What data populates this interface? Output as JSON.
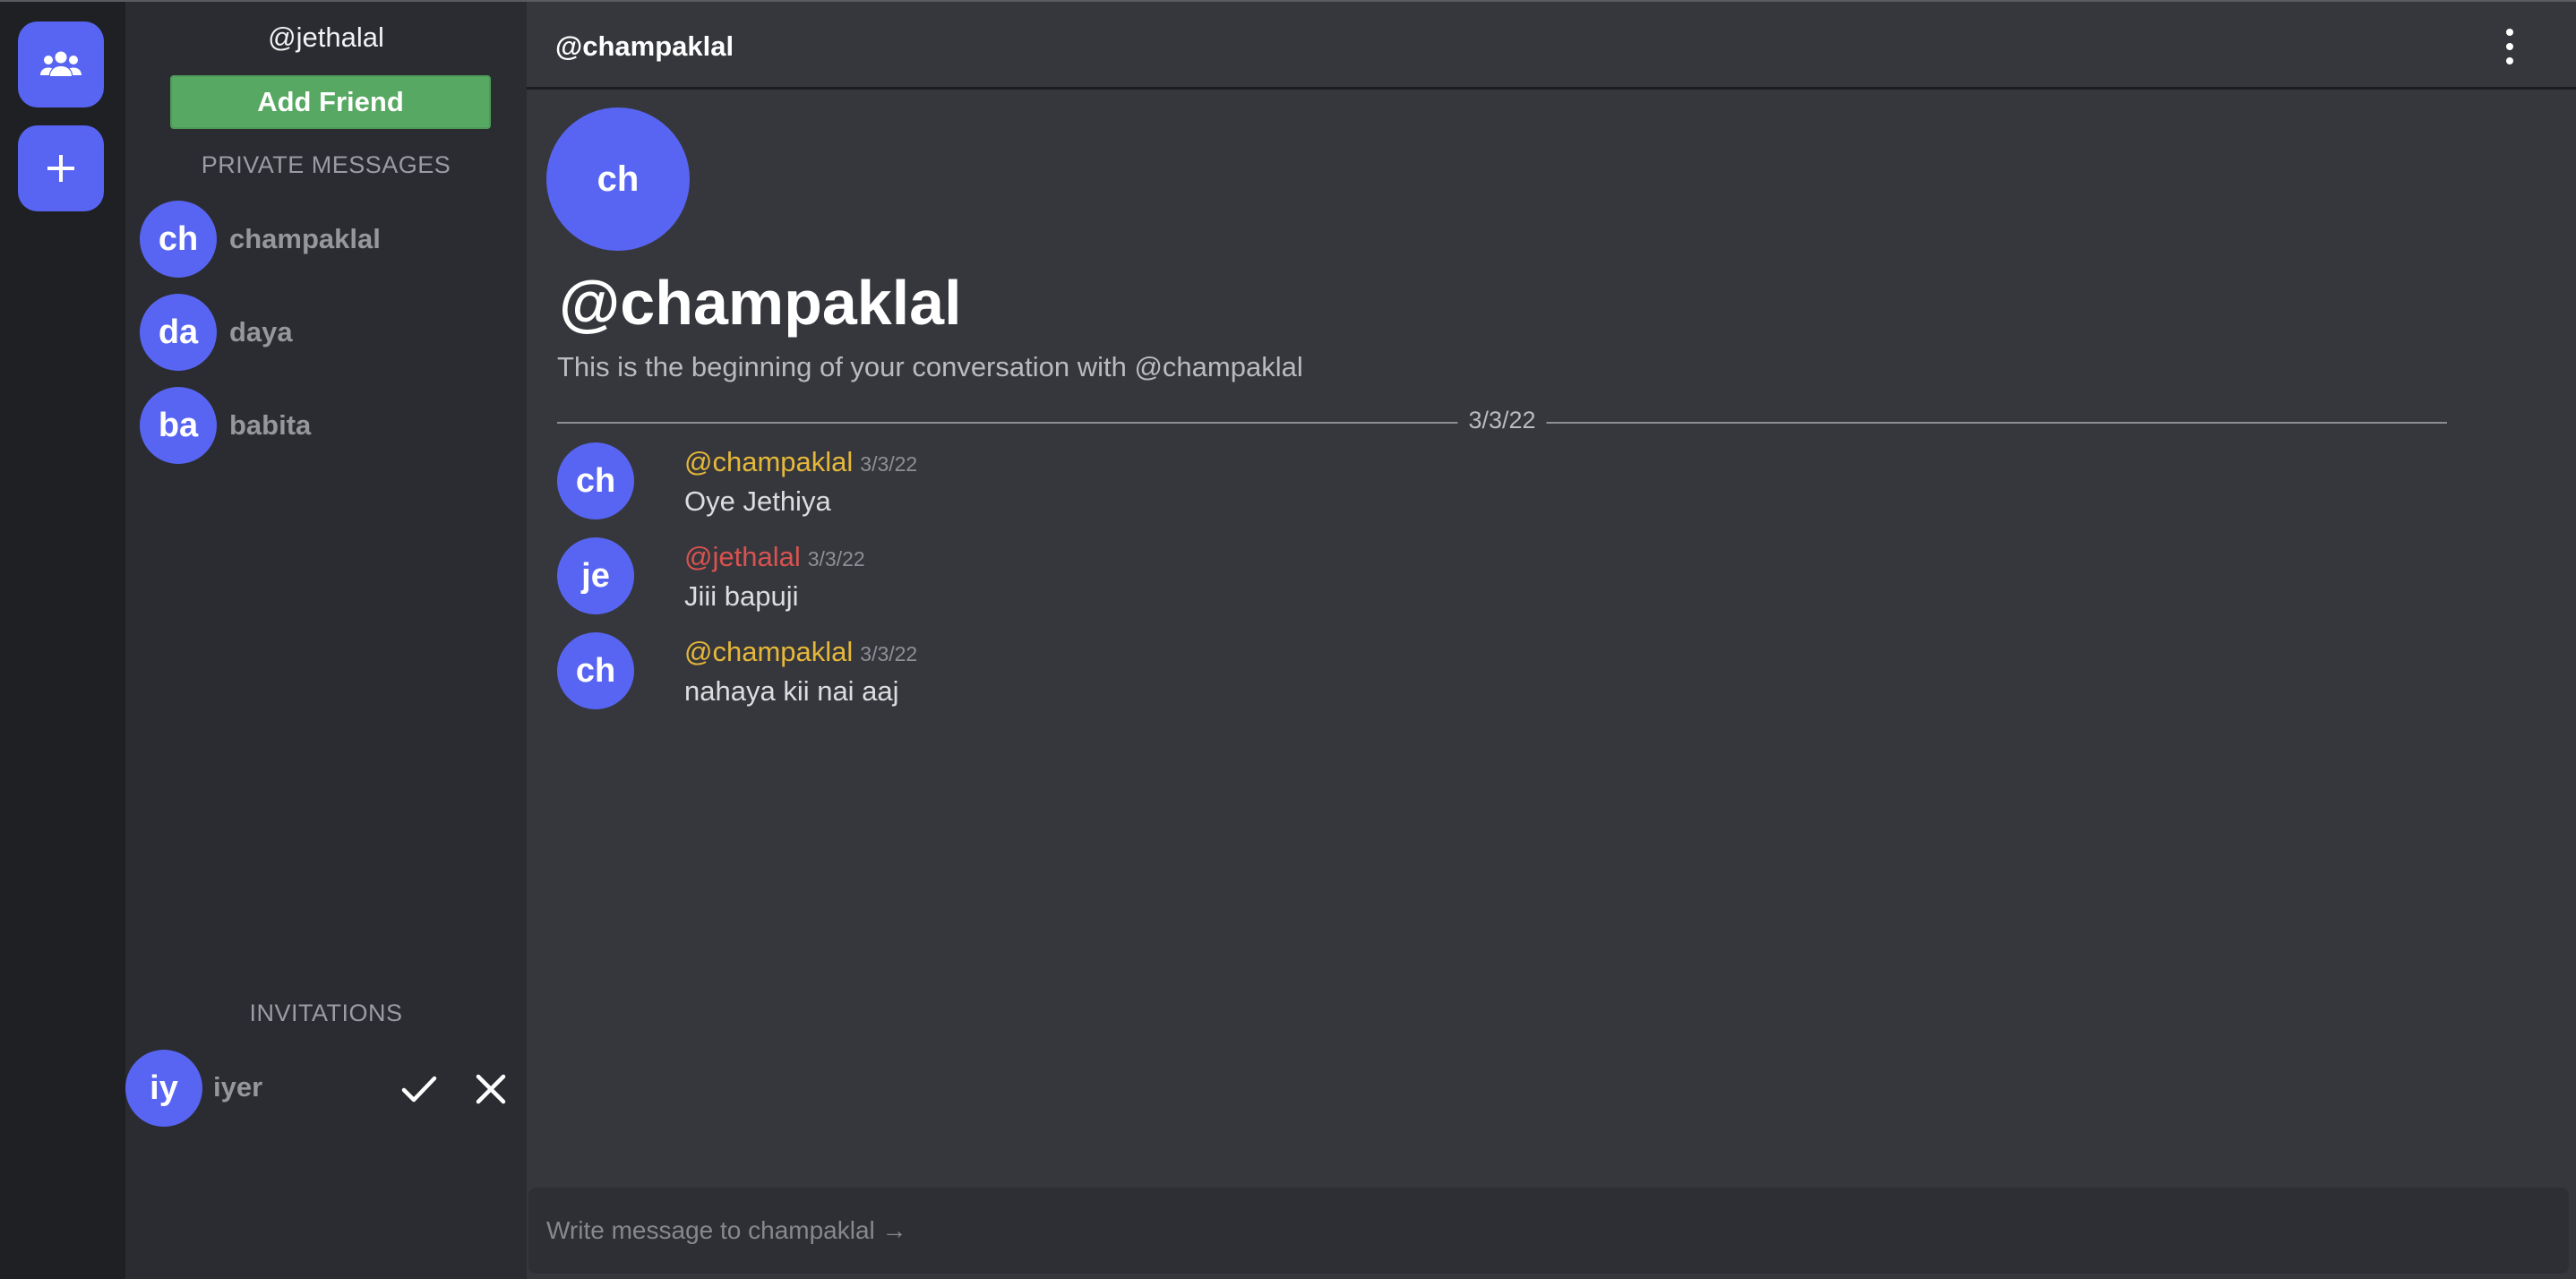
{
  "rail": {
    "friends_icon": "people-group-icon",
    "add_icon": "plus-icon"
  },
  "sidebar": {
    "username": "@jethalal",
    "add_friend_label": "Add Friend",
    "private_messages_label": "PRIVATE MESSAGES",
    "dms": [
      {
        "initials": "ch",
        "name": "champaklal"
      },
      {
        "initials": "da",
        "name": "daya"
      },
      {
        "initials": "ba",
        "name": "babita"
      }
    ],
    "invitations_label": "INVITATIONS",
    "invitations": [
      {
        "initials": "iy",
        "name": "iyer",
        "accept_icon": "check-icon",
        "decline_icon": "close-icon"
      }
    ]
  },
  "header": {
    "title": "@champaklal",
    "menu_icon": "kebab-menu-icon"
  },
  "conversation": {
    "avatar_initials": "ch",
    "title": "@champaklal",
    "subtitle": "This is the beginning of your conversation with @champaklal",
    "date_divider": "3/3/22"
  },
  "messages": [
    {
      "initials": "ch",
      "author": "@champaklal",
      "author_color": "#e6b83a",
      "time": "3/3/22",
      "text": "Oye Jethiya"
    },
    {
      "initials": "je",
      "author": "@jethalal",
      "author_color": "#d9534f",
      "time": "3/3/22",
      "text": "Jiii bapuji"
    },
    {
      "initials": "ch",
      "author": "@champaklal",
      "author_color": "#e6b83a",
      "time": "3/3/22",
      "text": "nahaya kii nai aaj"
    }
  ],
  "composer": {
    "placeholder": "Write message to champaklal →",
    "value": ""
  },
  "colors": {
    "accent": "#5865f2",
    "add_friend_green": "#57a862"
  }
}
